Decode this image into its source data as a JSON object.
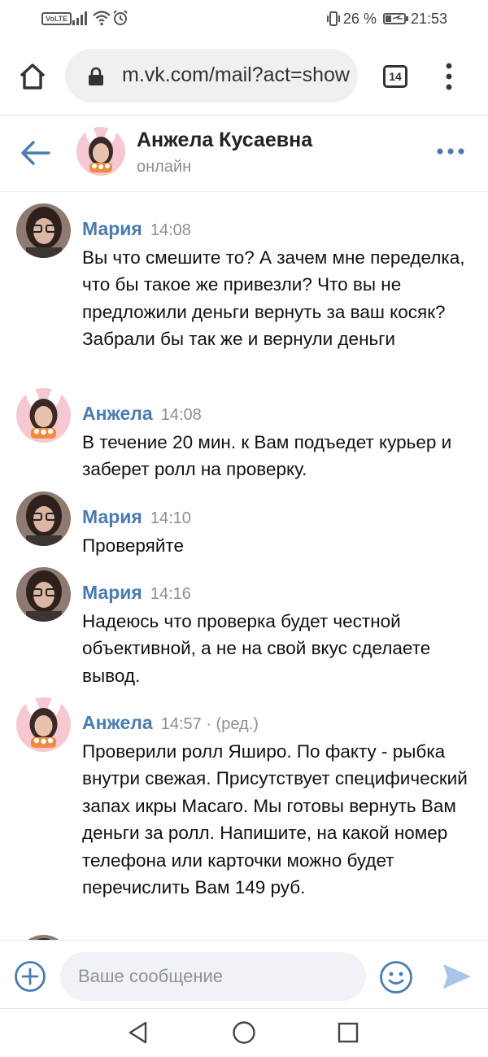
{
  "status_bar": {
    "volte": "VoLTE",
    "battery_percent": "26 %",
    "time": "21:53"
  },
  "browser": {
    "url": "m.vk.com/mail?act=show",
    "tab_count": "14"
  },
  "chat": {
    "title": "Анжела Кусаевна",
    "status": "онлайн"
  },
  "messages": [
    {
      "author": "Мария",
      "time": "14:08",
      "edited": "",
      "text": "Вы что смешите то? А зачем мне переделка, что бы такое же привезли? Что вы не предложили деньги вернуть за ваш косяк? Забрали бы так же и вернули деньги"
    },
    {
      "author": "Анжела",
      "time": "14:08",
      "edited": "",
      "text": "В течение 20 мин. к Вам подъедет курьер и заберет ролл на проверку."
    },
    {
      "author": "Мария",
      "time": "14:10",
      "edited": "",
      "text": "Проверяйте"
    },
    {
      "author": "Мария",
      "time": "14:16",
      "edited": "",
      "text": "Надеюсь что проверка будет честной объективной, а не на свой вкус сделаете вывод."
    },
    {
      "author": "Анжела",
      "time": "14:57",
      "edited": " · (ред.)",
      "text": "Проверили ролл Яширо. По факту - рыбка внутри свежая. Присутствует специфический запах икры Масаго. Мы готовы вернуть Вам деньги за ролл. Напишите, на какой номер телефона или карточки можно будет перечислить Вам 149 руб."
    }
  ],
  "compose": {
    "placeholder": "Ваше сообщение"
  },
  "colors": {
    "accent": "#4a7cb1",
    "secondary_text": "#8a8f94",
    "send_icon": "#a8c4e6"
  },
  "icons": [
    "home-icon",
    "lock-icon",
    "tabs-icon",
    "menu-dots-icon",
    "back-arrow-icon",
    "more-dots-icon",
    "plus-icon",
    "smile-icon",
    "send-icon",
    "nav-back-icon",
    "nav-home-icon",
    "nav-recent-icon"
  ]
}
